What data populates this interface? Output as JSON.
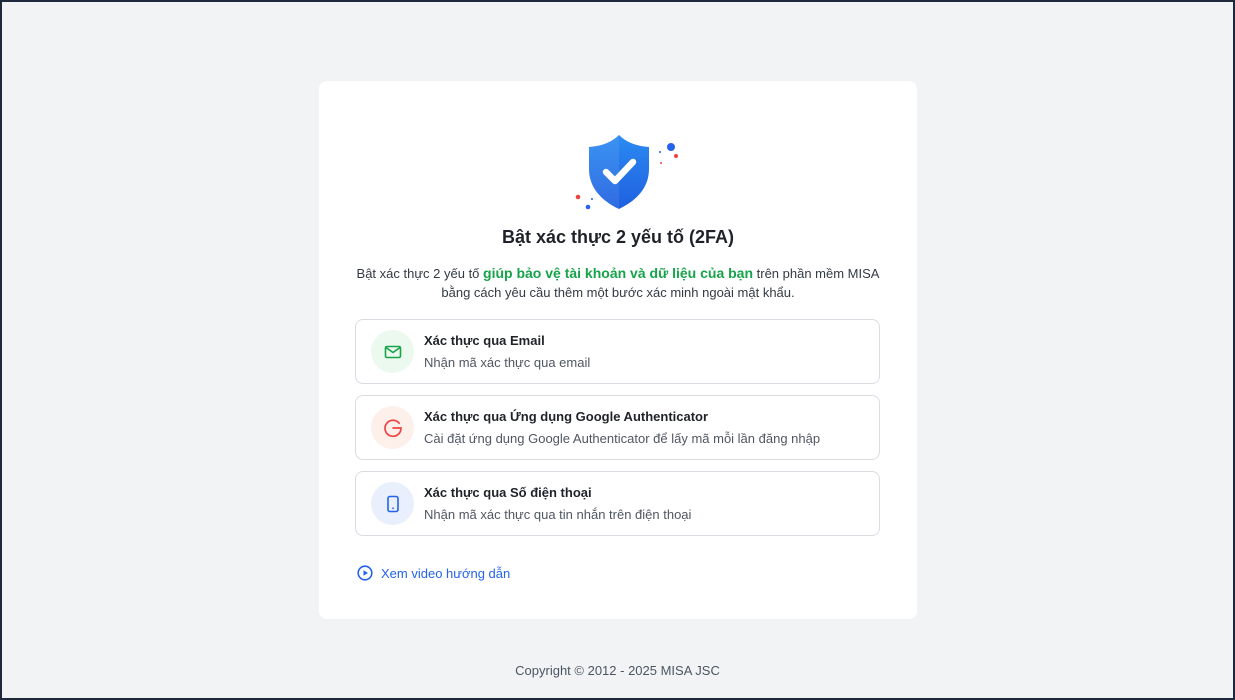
{
  "card": {
    "title": "Bật xác thực 2 yếu tố (2FA)",
    "description_before": "Bật xác thực 2 yếu tố ",
    "description_highlight": "giúp bảo vệ tài khoản và dữ liệu của bạn",
    "description_after": " trên phần mềm MISA bằng cách yêu cầu thêm một bước xác minh ngoài mật khẩu."
  },
  "options": [
    {
      "title": "Xác thực qua Email",
      "subtitle": "Nhận mã xác thực qua email",
      "icon": "mail-icon",
      "color": "#16a34a"
    },
    {
      "title": "Xác thực qua Ứng dụng Google Authenticator",
      "subtitle": "Cài đặt ứng dụng Google Authenticator để lấy mã mỗi lần đăng nhập",
      "icon": "google-icon",
      "color": "#ef4444"
    },
    {
      "title": "Xác thực qua Số điện thoại",
      "subtitle": "Nhận mã xác thực qua tin nhắn trên điện thoại",
      "icon": "phone-icon",
      "color": "#2563eb"
    }
  ],
  "video_link": {
    "label": "Xem video hướng dẫn",
    "icon": "play-circle-icon"
  },
  "footer": {
    "copyright": "Copyright © 2012 - 2025 MISA JSC"
  },
  "colors": {
    "accent": "#2563eb",
    "highlight": "#16a34a",
    "background": "#f2f3f5"
  }
}
